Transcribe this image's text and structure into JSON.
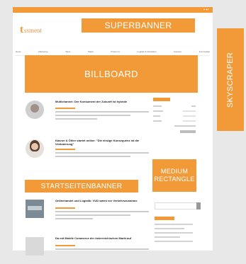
{
  "ads": {
    "superbanner": "SUPERBANNER",
    "billboard": "BILLBOARD",
    "skyscraper": "SKYSCRAPER",
    "medium_rectangle": [
      "MEDIUM",
      "RECTANGLE"
    ],
    "startseitenbanner": "STARTSEITENBANNER"
  },
  "site": {
    "logo": {
      "mark": "t",
      "word": "ssment"
    },
    "topstrip": "▪ ▪▪",
    "nav": [
      "News",
      "Marketing",
      "Tipps",
      "Markt",
      "Praxis Ist",
      "Logistik & Abwicklen",
      "Karriere",
      "Kurzmeldet"
    ]
  },
  "articles": [
    {
      "headline": "Multichannel: Der Konsument der Zukunft ist hybride"
    },
    {
      "headline": "Kasner & Öhler startet online: \"Die einzige Konsequenz ist die Veränderung\""
    },
    {
      "headline": "Onlinehandel und Logistik: VUD warnt vor Verkehrszunahme"
    },
    {
      "headline": "Da mit Mobile Commerce der österreichischen Markt auf"
    }
  ]
}
